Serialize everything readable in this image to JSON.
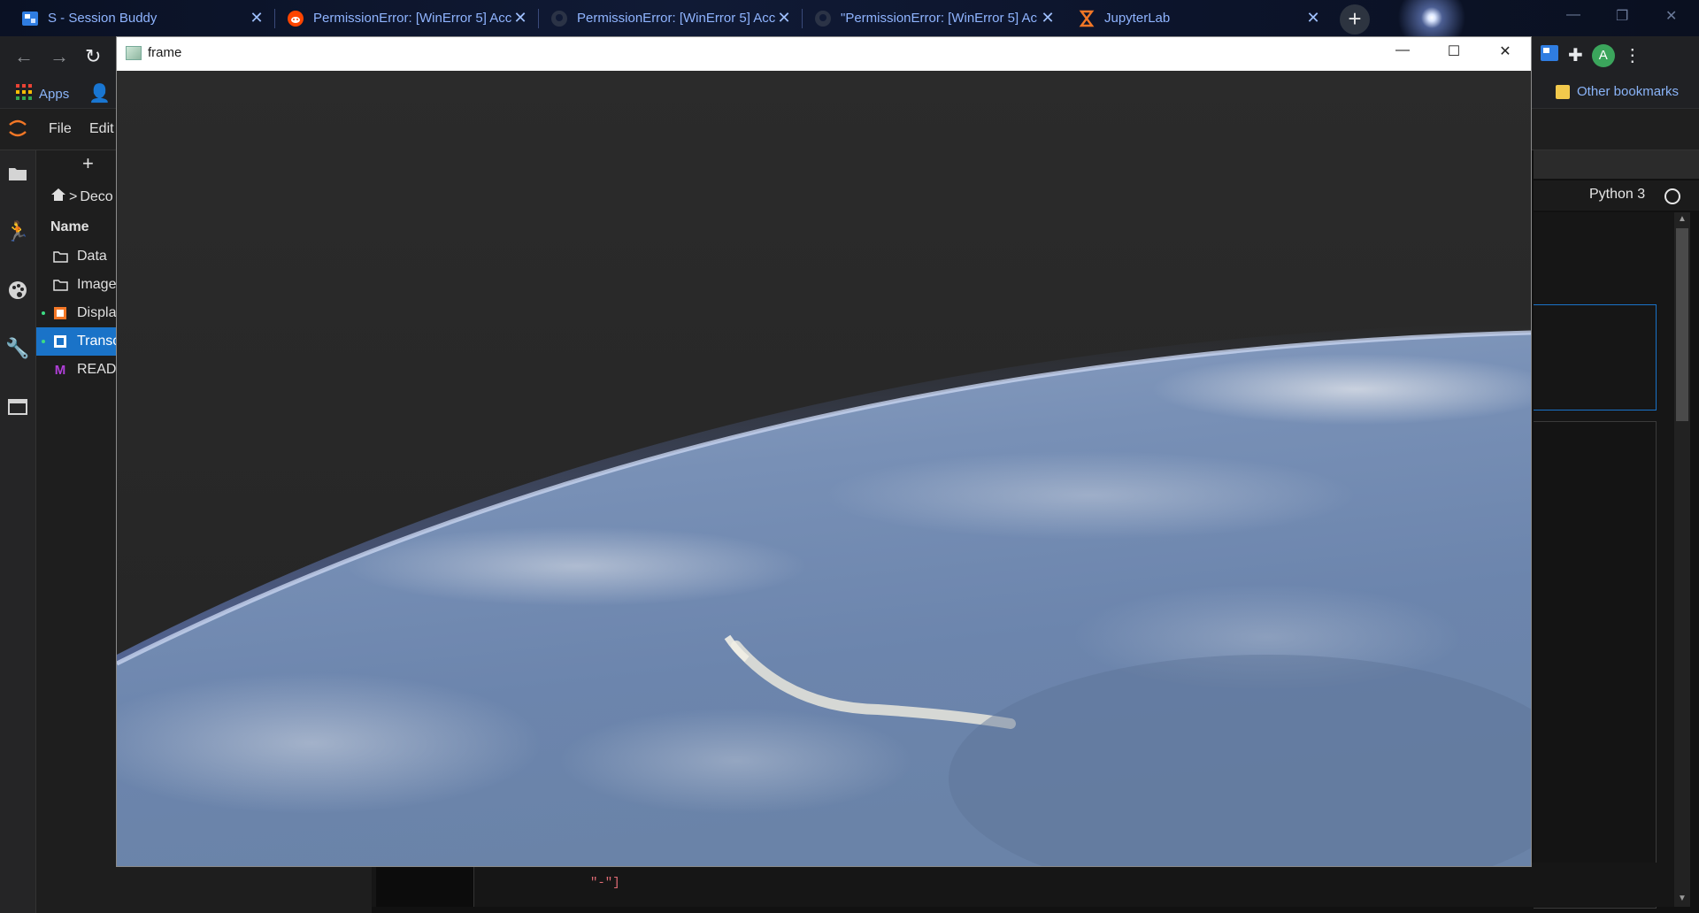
{
  "browser": {
    "tabs": [
      {
        "title": "S - Session Buddy",
        "icon": "session-buddy-icon"
      },
      {
        "title": "PermissionError: [WinError 5] Acc",
        "icon": "reddit-icon"
      },
      {
        "title": "PermissionError: [WinError 5] Acc",
        "icon": "github-icon"
      },
      {
        "title": "\"PermissionError: [WinError 5] Ac",
        "icon": "github-icon"
      },
      {
        "title": "JupyterLab",
        "icon": "jupyter-icon"
      }
    ],
    "new_tab_label": "+",
    "bookmarks": {
      "apps_label": "Apps",
      "other_label": "Other bookmarks"
    },
    "profile_initial": "A",
    "colors": {
      "tab_text": "#8fb4ff",
      "accent": "#8ab4f8"
    }
  },
  "jupyter": {
    "menu": {
      "file": "File",
      "edit": "Edit"
    },
    "breadcrumb": "Deco",
    "filebrowser": {
      "header": "Name",
      "new_button": "+",
      "items": [
        {
          "name": "Data",
          "icon": "folder-icon",
          "selected": false,
          "running": false
        },
        {
          "name": "Image",
          "icon": "folder-icon",
          "selected": false,
          "running": false
        },
        {
          "name": "Displa",
          "icon": "notebook-icon",
          "selected": false,
          "running": true
        },
        {
          "name": "Transc",
          "icon": "notebook-icon",
          "selected": true,
          "running": true
        },
        {
          "name": "READN",
          "icon": "markdown-icon",
          "selected": false,
          "running": false
        }
      ]
    },
    "kernel": "Python 3",
    "code_tail": "\"-\"]",
    "colors": {
      "selection": "#1a73c8"
    }
  },
  "frame_window": {
    "title": "frame",
    "content": "earth-horizon-from-space-video-frame"
  }
}
